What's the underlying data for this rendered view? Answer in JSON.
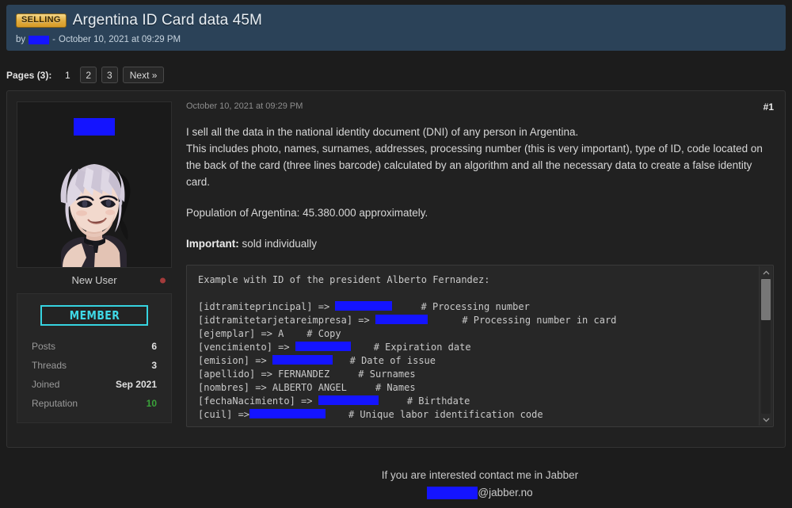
{
  "header": {
    "badge": "SELLING",
    "title": "Argentina ID Card data 45M",
    "by_label": "by",
    "author_redacted": "",
    "separator": "-",
    "date": "October 10, 2021 at 09:29 PM",
    "bg_color": "#2b4258",
    "badge_color": "#e0ab3d"
  },
  "pagination": {
    "label": "Pages (3):",
    "pages": [
      {
        "label": "1",
        "current": true
      },
      {
        "label": "2",
        "current": false
      },
      {
        "label": "3",
        "current": false
      }
    ],
    "next_label": "Next »"
  },
  "user": {
    "username_redacted": "",
    "title": "New User",
    "status": "offline",
    "status_color": "#a33b3b",
    "group_badge": "MEMBER",
    "badge_color": "#36d3e0",
    "stats": [
      {
        "key": "Posts",
        "value": "6",
        "highlight": false
      },
      {
        "key": "Threads",
        "value": "3",
        "highlight": false
      },
      {
        "key": "Joined",
        "value": "Sep 2021",
        "highlight": false
      },
      {
        "key": "Reputation",
        "value": "10",
        "highlight": true
      }
    ],
    "reputation_color": "#3aa33a"
  },
  "post": {
    "date": "October 10, 2021 at 09:29 PM",
    "number": "#1",
    "paragraphs": [
      "I sell all the data in the national identity document (DNI) of any person in Argentina.\nThis includes photo, names, surnames, addresses, processing number (this is very important), type of ID, code located on the back of the card (three lines barcode) calculated by an algorithm and all the necessary data to create a false identity card.",
      "Population of Argentina: 45.380.000 approximately."
    ],
    "important_label": "Important:",
    "important_text": " sold individually"
  },
  "code_block": {
    "intro": "Example with ID of the president Alberto Fernandez:",
    "lines": [
      {
        "key": "[idtramiteprincipal] =>",
        "redacted_width": 72,
        "gap": 5,
        "comment": "# Processing number"
      },
      {
        "key": "[idtramitetarjetareimpresa] =>",
        "redacted_width": 66,
        "gap": 6,
        "comment": "# Processing number in card"
      },
      {
        "key": "[ejemplar] => A",
        "redacted_width": 0,
        "gap": 4,
        "comment": "# Copy"
      },
      {
        "key": "[vencimiento] =>",
        "redacted_width": 70,
        "gap": 5,
        "comment": "# Expiration date"
      },
      {
        "key": "[emision] =>",
        "redacted_width": 76,
        "gap": 4,
        "comment": "# Date of issue"
      },
      {
        "key": "[apellido] => FERNANDEZ",
        "redacted_width": 0,
        "gap": 5,
        "comment": "# Surnames"
      },
      {
        "key": "[nombres] => ALBERTO ANGEL",
        "redacted_width": 0,
        "gap": 5,
        "comment": "# Names"
      },
      {
        "key": "[fechaNacimiento] =>",
        "redacted_width": 76,
        "gap": 6,
        "comment": "# Birthdate"
      },
      {
        "key": "[cuil] =>",
        "redacted_width": 96,
        "gap": 4,
        "comment": "# Unique labor identification code"
      }
    ],
    "scroll_position": "top"
  },
  "footer": {
    "line1": "If you are interested contact me in Jabber",
    "jabber_redacted": "",
    "jabber_domain": "@jabber.no"
  }
}
